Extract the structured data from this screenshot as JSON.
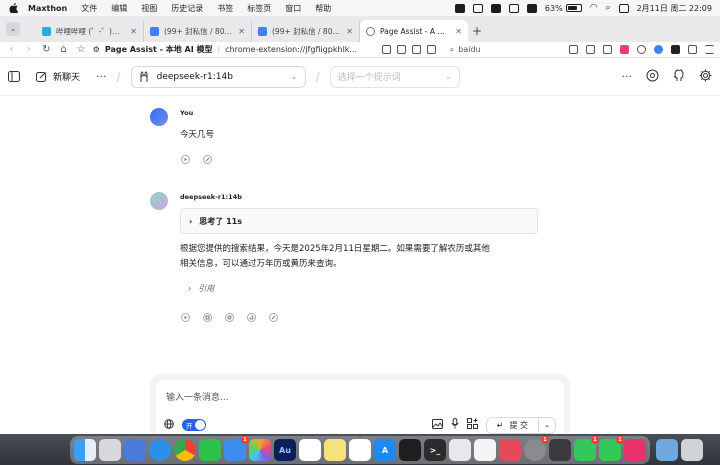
{
  "menubar": {
    "app": "Maxthon",
    "items": [
      "文件",
      "编辑",
      "视图",
      "历史记录",
      "书签",
      "标签页",
      "窗口",
      "帮助"
    ],
    "battery_percent": "63%",
    "datetime": "2月11日 周二 22:09"
  },
  "tabs": [
    {
      "label": "哔哩哔哩 (゜-゜)つロ 干",
      "active": false,
      "color": "#23ade5"
    },
    {
      "label": "(99+ 封私信 / 80 条消息",
      "active": false,
      "color": "#3b82f6"
    },
    {
      "label": "(99+ 封私信 / 80 条消息",
      "active": false,
      "color": "#3b82f6"
    },
    {
      "label": "Page Assist - A Web UI",
      "active": true,
      "color": "#888888"
    }
  ],
  "address": {
    "page_title": "Page Assist - 本地 AI 模型",
    "url": "chrome-extension://jfgfiigpkhlk...",
    "search": "baidu"
  },
  "header": {
    "new_chat": "新聊天",
    "model": "deepseek-r1:14b",
    "prompt_placeholder": "选择一个提示词"
  },
  "messages": {
    "user": {
      "name": "You",
      "text": "今天几号"
    },
    "bot": {
      "name": "deepseek-r1:14b",
      "thinking": "思考了 11s",
      "line1": "根据您提供的搜索结果，今天是2025年2月11日星期二。如果需要了解农历或其他",
      "line2": "相关信息，可以通过万年历或黄历来查询。",
      "citation": "引用"
    }
  },
  "composer": {
    "placeholder": "输入一条消息...",
    "toggle_label": "开",
    "submit_label": "提 交"
  },
  "colors": {
    "accent": "#2563eb",
    "user_avatar": "#3b6fe0",
    "bot_avatar": "#9fd7c7"
  },
  "dock": {
    "badges": {
      "chat": "1",
      "app7": "1",
      "app19": "1",
      "app20": "1"
    }
  }
}
